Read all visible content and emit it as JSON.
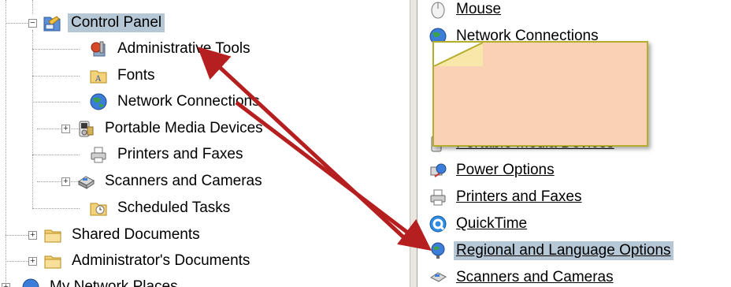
{
  "folder_tree": {
    "items": [
      {
        "label": "Control Panel",
        "selected": true
      },
      {
        "label": "Administrative Tools"
      },
      {
        "label": "Fonts"
      },
      {
        "label": "Network Connections"
      },
      {
        "label": "Portable Media Devices"
      },
      {
        "label": "Printers and Faxes"
      },
      {
        "label": "Scanners and Cameras"
      },
      {
        "label": "Scheduled Tasks"
      },
      {
        "label": "Shared Documents"
      },
      {
        "label": "Administrator's Documents"
      },
      {
        "label": "My Network Places"
      }
    ]
  },
  "control_panel_list": {
    "items": [
      {
        "label": "Mouse"
      },
      {
        "label": "Network Connections"
      },
      {
        "label": "Portable Media Devices"
      },
      {
        "label": "Power Options"
      },
      {
        "label": "Printers and Faxes"
      },
      {
        "label": "QuickTime"
      },
      {
        "label": "Regional and Language Options",
        "selected": true
      },
      {
        "label": "Scanners and Cameras"
      }
    ]
  },
  "colors": {
    "selection": "#b6c7d6",
    "note_fill": "#f9d1b4",
    "note_border": "#b7ad2d",
    "arrow": "#b51f1f"
  }
}
